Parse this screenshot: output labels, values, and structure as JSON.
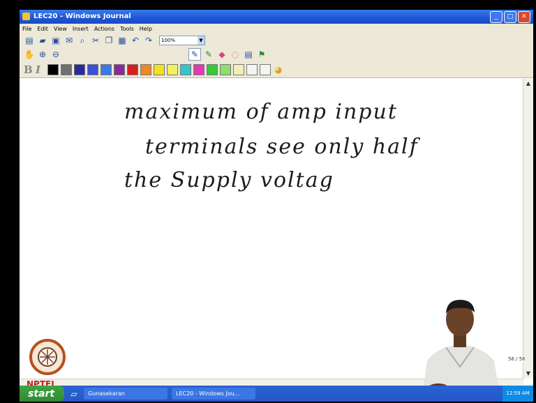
{
  "window": {
    "title": "LEC20 - Windows Journal"
  },
  "menu": [
    "File",
    "Edit",
    "View",
    "Insert",
    "Actions",
    "Tools",
    "Help"
  ],
  "toolbar": {
    "zoom": "100%"
  },
  "format": {
    "bold": "B",
    "italic": "I"
  },
  "palette": [
    "#000000",
    "#707070",
    "#2a2a9e",
    "#3c50d8",
    "#3a7be0",
    "#8a2a9a",
    "#d81e1e",
    "#ee8822",
    "#f3e21a",
    "#f3f25b",
    "#34c6c6",
    "#e23ab1",
    "#37c937",
    "#8be06a",
    "#f3eeb4",
    "#f4f4f4",
    "#f4f4f4"
  ],
  "notes": {
    "lines": [
      "maximum of amp input",
      "terminals see only half",
      "the Supply voltag"
    ]
  },
  "page_indicator": "56 / 56",
  "logo": "NPTEL",
  "taskbar": {
    "start": "start",
    "tasks": [
      "Gunasekaran",
      "LEC20 - Windows Jou..."
    ],
    "clock": "12:59 AM"
  }
}
